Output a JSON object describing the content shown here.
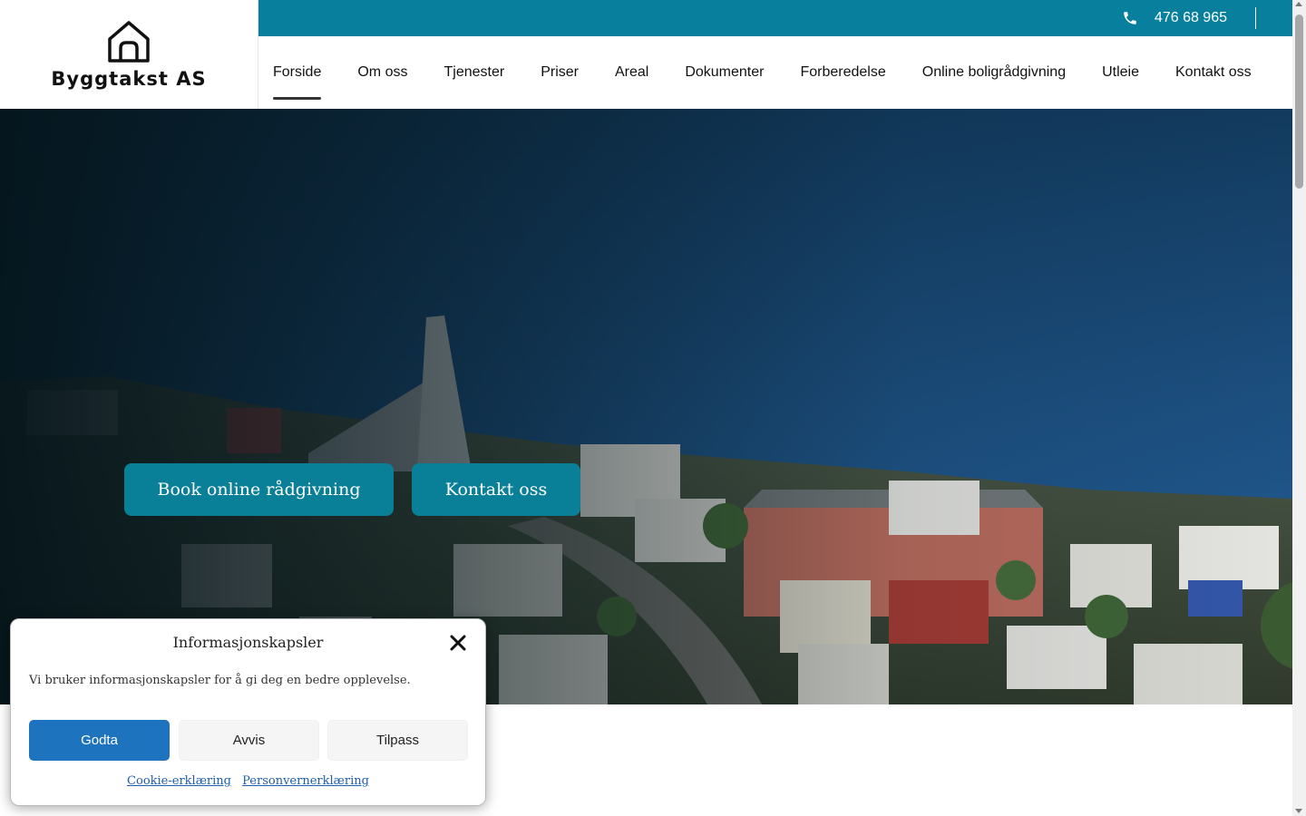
{
  "brand": {
    "name": "Byggtakst AS"
  },
  "topbar": {
    "phone": "476 68 965",
    "color": "#087f9c"
  },
  "nav": {
    "items": [
      {
        "label": "Forside",
        "active": true
      },
      {
        "label": "Om oss"
      },
      {
        "label": "Tjenester"
      },
      {
        "label": "Priser"
      },
      {
        "label": "Areal"
      },
      {
        "label": "Dokumenter"
      },
      {
        "label": "Forberedelse"
      },
      {
        "label": "Online boligrådgivning"
      },
      {
        "label": "Utleie"
      },
      {
        "label": "Kontakt oss"
      }
    ]
  },
  "hero": {
    "buttons": {
      "book": "Book online rådgivning",
      "contact": "Kontakt oss"
    },
    "button_color": "#0a7f98"
  },
  "cookie": {
    "title": "Informasjonskapsler",
    "message": "Vi bruker informasjonskapsler for å gi deg en bedre opplevelse.",
    "accept": "Godta",
    "deny": "Avvis",
    "customize": "Tilpass",
    "links": {
      "cookie_policy": "Cookie-erklæring",
      "privacy_policy": "Personvernerklæring"
    },
    "accept_color": "#1e73be"
  },
  "icons": {
    "logo": "house-outline-icon",
    "phone": "phone-icon",
    "close": "close-icon"
  }
}
